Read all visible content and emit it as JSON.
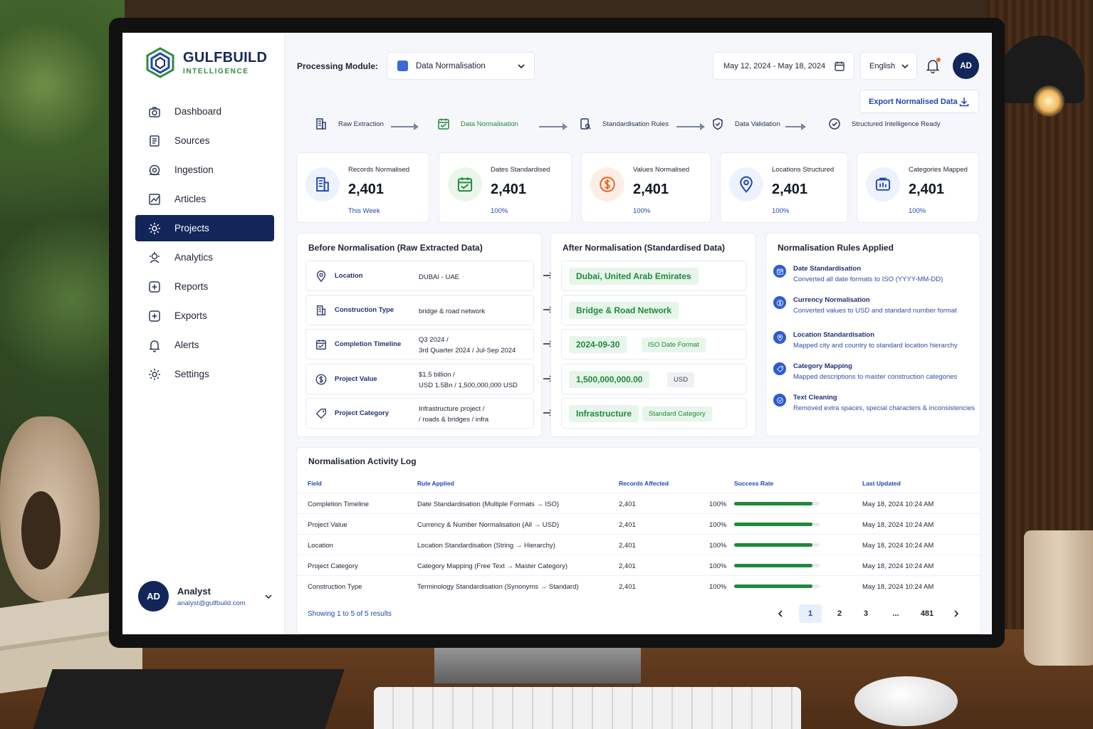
{
  "brand": {
    "name": "GULFBUILD",
    "tagline": "INTELLIGENCE"
  },
  "sidebar": {
    "items": [
      {
        "label": "Dashboard",
        "icon": "camera-icon",
        "active": false
      },
      {
        "label": "Sources",
        "icon": "document-icon",
        "active": false
      },
      {
        "label": "Ingestion",
        "icon": "ingestion-icon",
        "active": false
      },
      {
        "label": "Articles",
        "icon": "chart-icon",
        "active": false
      },
      {
        "label": "Projects",
        "icon": "gear-icon",
        "active": true
      },
      {
        "label": "Analytics",
        "icon": "analytics-icon",
        "active": false
      },
      {
        "label": "Reports",
        "icon": "plus-box-icon",
        "active": false
      },
      {
        "label": "Exports",
        "icon": "plus-box-icon",
        "active": false
      },
      {
        "label": "Alerts",
        "icon": "bell-icon",
        "active": false
      },
      {
        "label": "Settings",
        "icon": "gear-icon",
        "active": false
      }
    ],
    "user": {
      "initials": "AD",
      "name": "Analyst",
      "email": "analyst@gulfbuild.com"
    }
  },
  "topbar": {
    "module_label": "Processing Module:",
    "module_value": "Data Normalisation",
    "date_range": "May 12, 2024 - May 18, 2024",
    "language": "English",
    "avatar": "AD",
    "export_label": "Export Normalised Data"
  },
  "pipeline": [
    {
      "label": "Raw Extraction",
      "current": false
    },
    {
      "label": "Data Normalisation",
      "current": true
    },
    {
      "label": "Standardisation Rules",
      "current": false
    },
    {
      "label": "Data Validation",
      "current": false
    },
    {
      "label": "Structured Intelligence Ready",
      "current": false
    }
  ],
  "stats": [
    {
      "label": "Records Normalised",
      "value": "2,401",
      "sub": "This Week",
      "icon": "building-icon"
    },
    {
      "label": "Dates Standardised",
      "value": "2,401",
      "sub": "100%",
      "icon": "calendar-icon"
    },
    {
      "label": "Values Normalised",
      "value": "2,401",
      "sub": "100%",
      "icon": "dollar-icon"
    },
    {
      "label": "Locations Structured",
      "value": "2,401",
      "sub": "100%",
      "icon": "location-pin-icon"
    },
    {
      "label": "Categories Mapped",
      "value": "2,401",
      "sub": "100%",
      "icon": "category-icon"
    }
  ],
  "before": {
    "title": "Before Normalisation (Raw Extracted Data)",
    "rows": [
      {
        "field": "Location",
        "raw": [
          "DUBAI - UAE"
        ],
        "icon": "location-pin-icon"
      },
      {
        "field": "Construction Type",
        "raw": [
          "bridge & road network"
        ],
        "icon": "building-icon"
      },
      {
        "field": "Completion Timeline",
        "raw": [
          "Q3 2024 /",
          "3rd Quarter 2024 / Jul-Sep 2024"
        ],
        "icon": "calendar-icon"
      },
      {
        "field": "Project Value",
        "raw": [
          "$1.5 billion /",
          "USD 1.5Bn / 1,500,000,000 USD"
        ],
        "icon": "dollar-icon"
      },
      {
        "field": "Project Category",
        "raw": [
          "Infrastructure project /",
          "/ roads & bridges / infra"
        ],
        "icon": "tag-icon"
      }
    ]
  },
  "after": {
    "title": "After Normalisation (Standardised Data)",
    "rows": [
      {
        "value": "Dubai, United Arab Emirates",
        "tag": "",
        "tag_style": ""
      },
      {
        "value": "Bridge & Road Network",
        "tag": "",
        "tag_style": ""
      },
      {
        "value": "2024-09-30",
        "tag": "ISO Date Format",
        "tag_style": "green"
      },
      {
        "value": "1,500,000,000.00",
        "tag": "USD",
        "tag_style": "gray"
      },
      {
        "value": "Infrastructure",
        "tag": "Standard Category",
        "tag_style": "green"
      }
    ]
  },
  "rules": {
    "title": "Normalisation Rules Applied",
    "items": [
      {
        "title": "Date Standardisation",
        "desc": "Converted all date formats to ISO (YYYY-MM-DD)"
      },
      {
        "title": "Currency Normalisation",
        "desc": "Converted values to USD and standard number format"
      },
      {
        "title": "Location Standardisation",
        "desc": "Mapped city and country to standard location hierarchy"
      },
      {
        "title": "Category Mapping",
        "desc": "Mapped descriptions to master construction categories"
      },
      {
        "title": "Text Cleaning",
        "desc": "Removed extra spaces, special characters & inconsistencies"
      }
    ]
  },
  "log": {
    "title": "Normalisation Activity Log",
    "headers": [
      "Field",
      "Rule Applied",
      "Records Affected",
      "Success Rate",
      "Last Updated"
    ],
    "rows": [
      {
        "field": "Completion Timeline",
        "rule": "Date Standardisation (Multiple Formats → ISO)",
        "records": "2,401",
        "rate": "100%",
        "rate_value": 100,
        "updated": "May 18, 2024 10:24 AM"
      },
      {
        "field": "Project Value",
        "rule": "Currency & Number Normalisation (All → USD)",
        "records": "2,401",
        "rate": "100%",
        "rate_value": 100,
        "updated": "May 18, 2024 10:24 AM"
      },
      {
        "field": "Location",
        "rule": "Location Standardisation (String → Hierarchy)",
        "records": "2,401",
        "rate": "100%",
        "rate_value": 100,
        "updated": "May 18, 2024 10:24 AM"
      },
      {
        "field": "Project Category",
        "rule": "Category Mapping (Free Text → Master Category)",
        "records": "2,401",
        "rate": "100%",
        "rate_value": 100,
        "updated": "May 18, 2024 10:24 AM"
      },
      {
        "field": "Construction Type",
        "rule": "Terminology Standardisation (Synonyms → Standard)",
        "records": "2,401",
        "rate": "100%",
        "rate_value": 100,
        "updated": "May 18, 2024 10:24 AM"
      }
    ],
    "showing": "Showing 1 to 5 of 5 results",
    "pages": [
      "1",
      "2",
      "3",
      "...",
      "481"
    ],
    "current_page": "1"
  },
  "colors": {
    "navy": "#13265a",
    "green": "#1f8a3b",
    "blue": "#1e47b5",
    "orange": "#f06a2c"
  }
}
